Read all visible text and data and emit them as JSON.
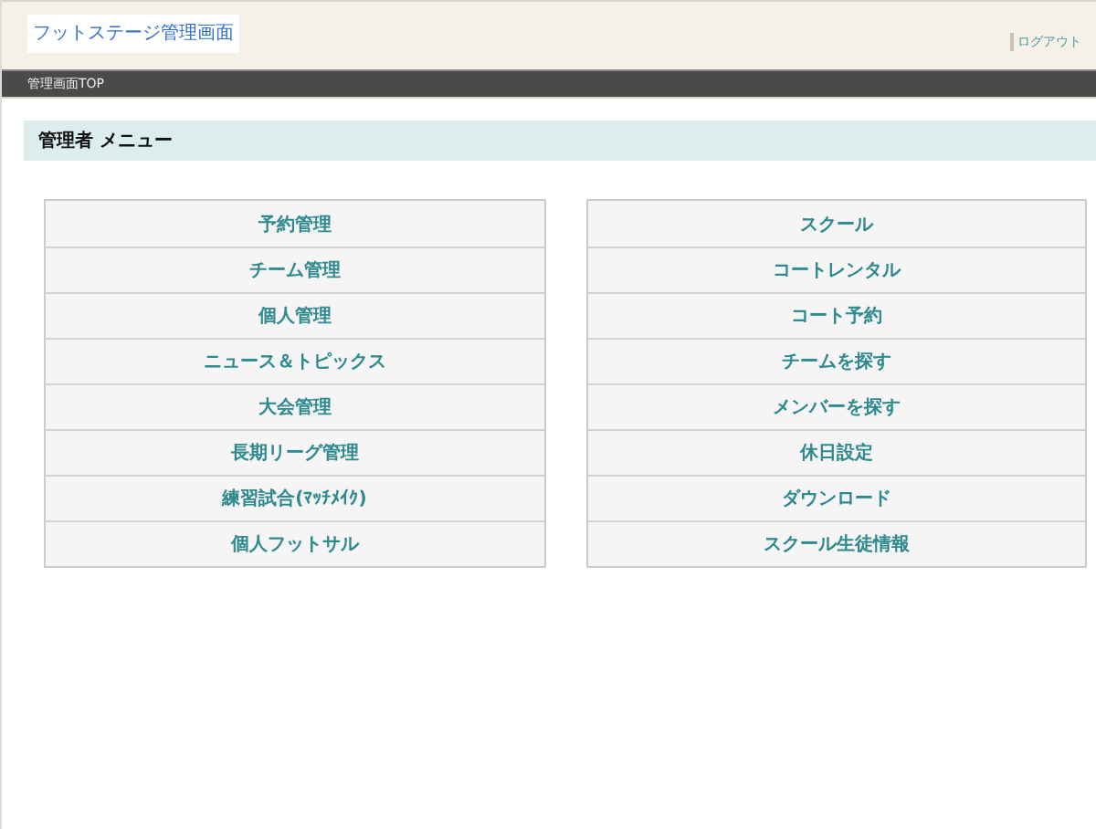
{
  "header": {
    "logo": "フットステージ管理画面",
    "logout": "ログアウト"
  },
  "breadcrumb": "管理画面TOP",
  "section_title": "管理者 メニュー",
  "menus": [
    [
      "予約管理",
      "チーム管理",
      "個人管理",
      "ニュース＆トピックス",
      "大会管理",
      "長期リーグ管理",
      "練習試合(ﾏｯﾁﾒｲｸ)",
      "個人フットサル"
    ],
    [
      "スクール",
      "コートレンタル",
      "コート予約",
      "チームを探す",
      "メンバーを探す",
      "休日設定",
      "ダウンロード",
      "スクール生徒情報"
    ]
  ]
}
